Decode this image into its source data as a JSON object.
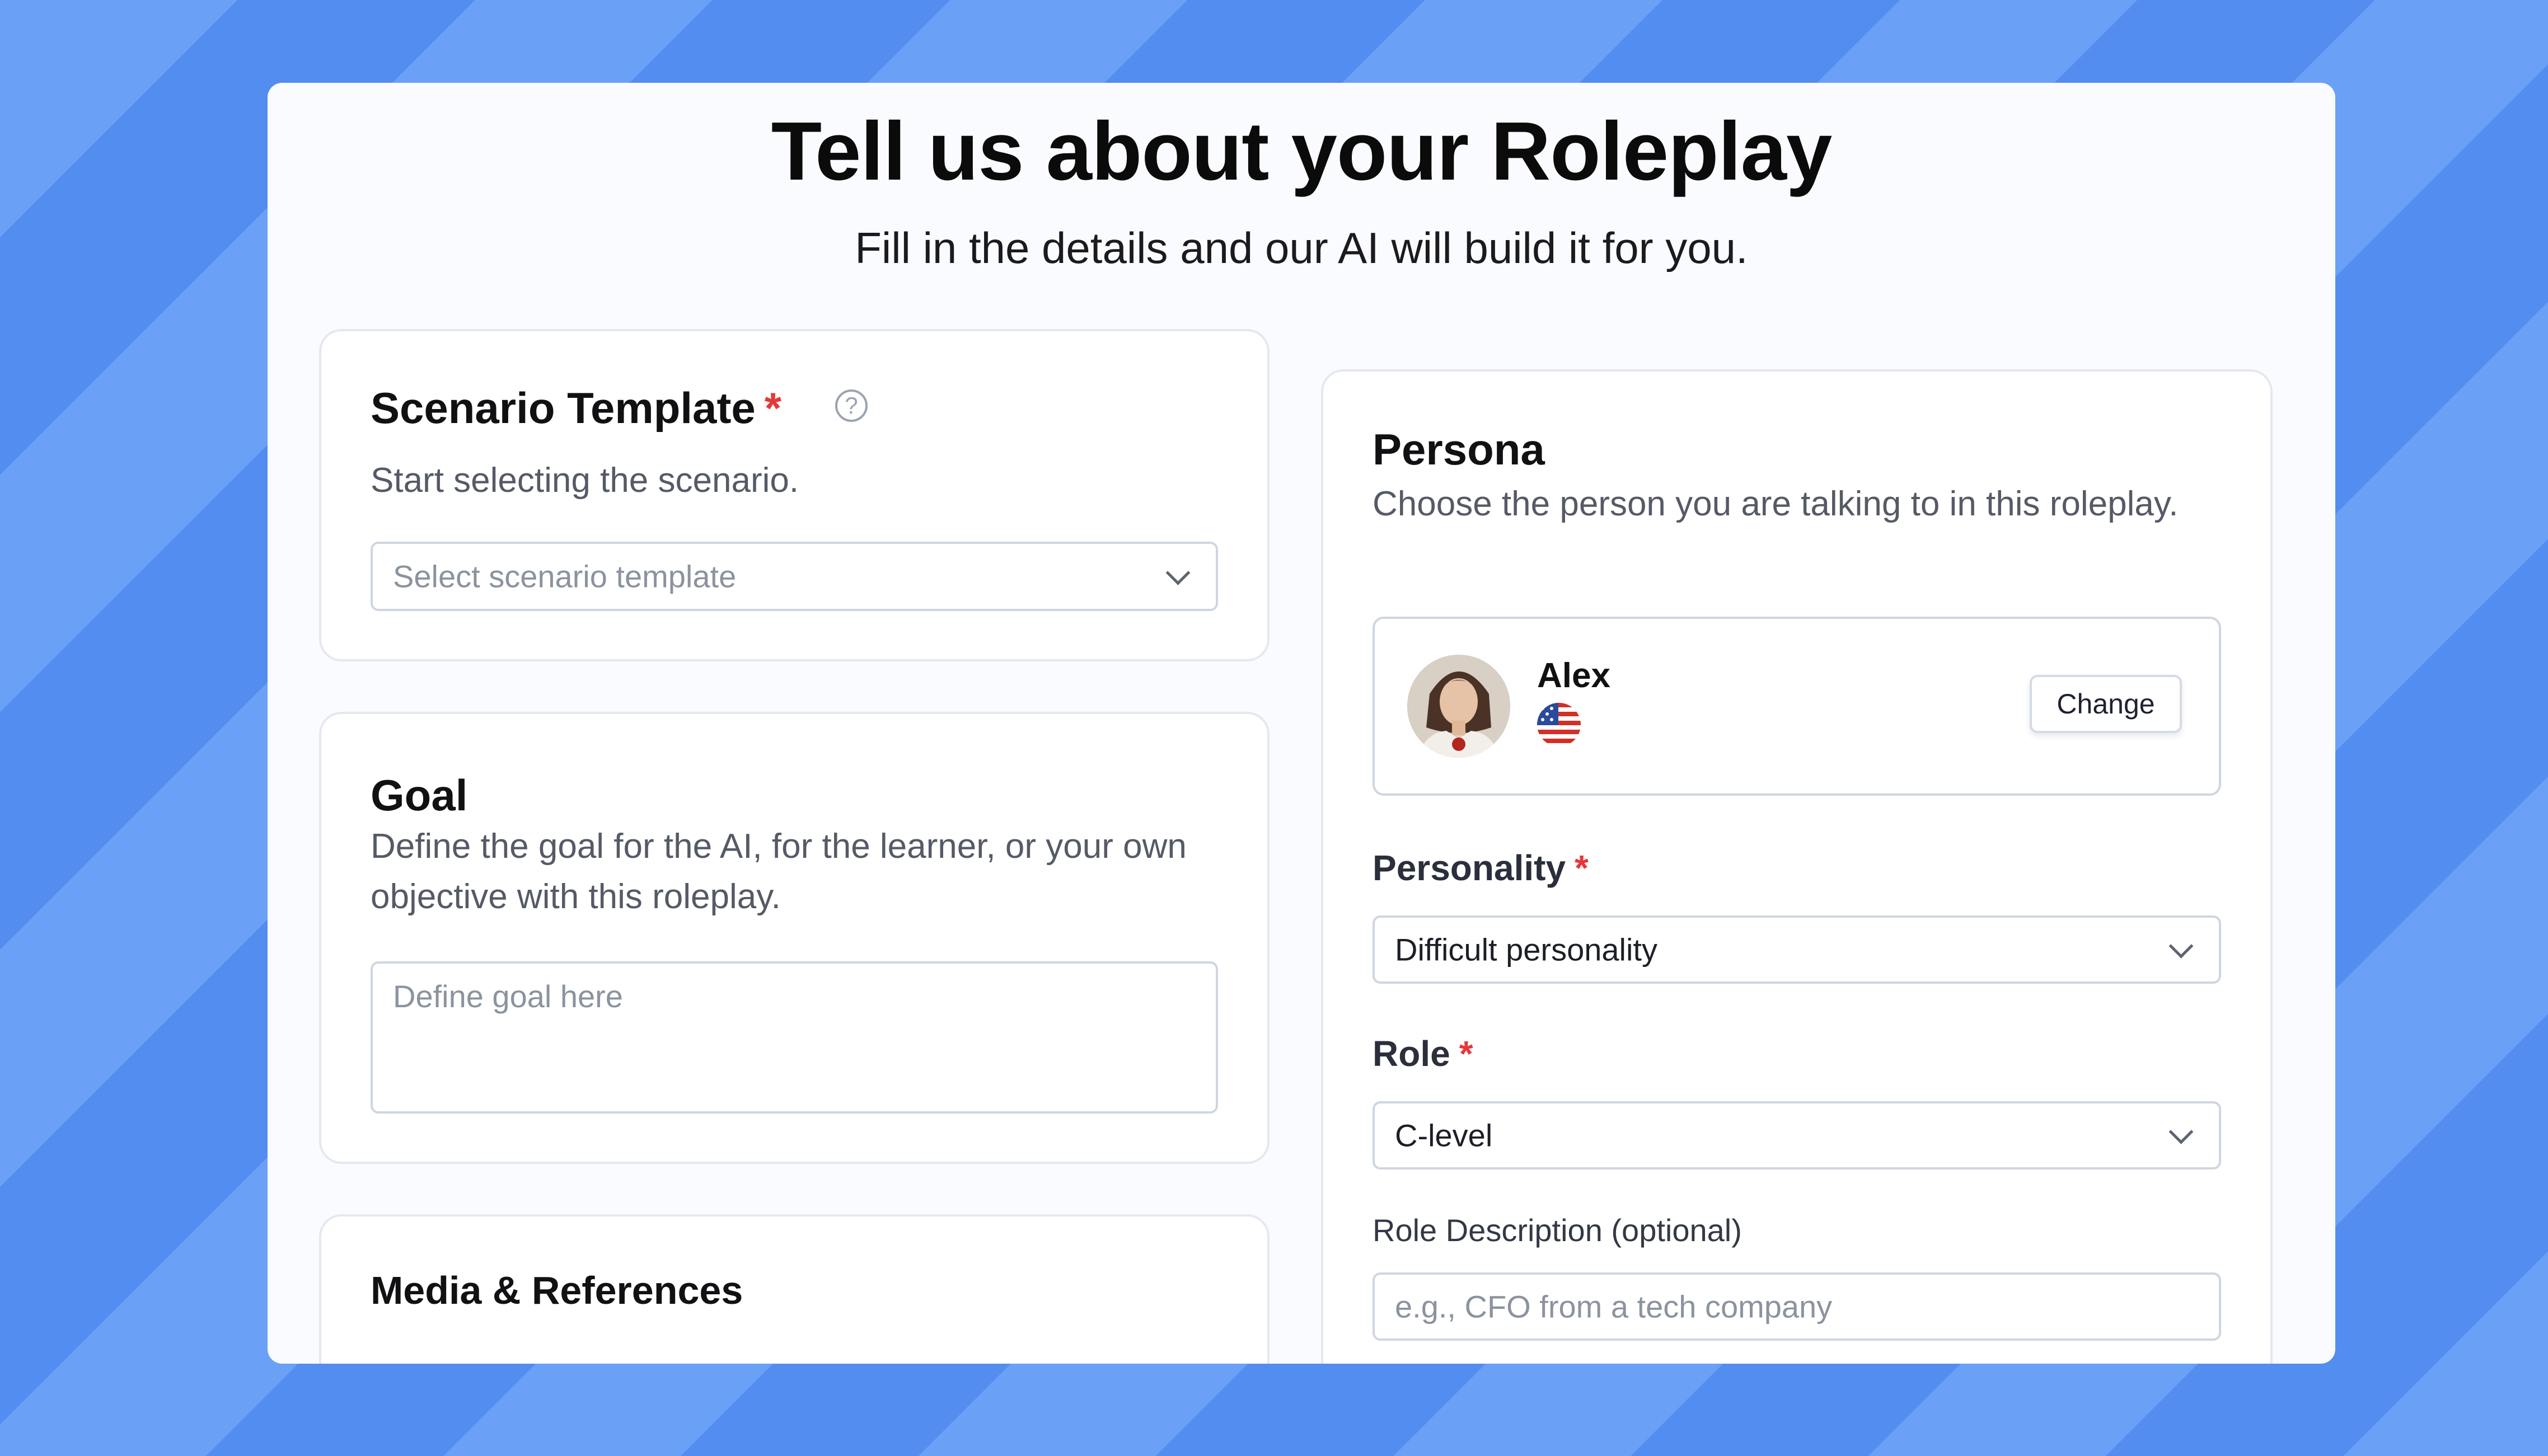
{
  "header": {
    "title": "Tell us about your Roleplay",
    "subtitle": "Fill in the details and our AI will build it for you."
  },
  "scenario": {
    "title": "Scenario Template",
    "required_mark": "*",
    "help_icon": "question-circle-icon",
    "help_glyph": "?",
    "description": "Start selecting the scenario.",
    "select_placeholder": "Select scenario template"
  },
  "goal": {
    "title": "Goal",
    "description": "Define the goal for the AI, for the learner, or your own objective with this roleplay.",
    "placeholder": "Define goal here"
  },
  "media": {
    "title": "Media & References"
  },
  "persona": {
    "title": "Persona",
    "description": "Choose the person you are talking to in this roleplay.",
    "selected": {
      "name": "Alex",
      "flag_icon": "us-flag-icon",
      "avatar_icon": "persona-avatar"
    },
    "change_label": "Change",
    "personality": {
      "label": "Personality",
      "required_mark": "*",
      "value": "Difficult personality"
    },
    "role": {
      "label": "Role",
      "required_mark": "*",
      "value": "C-level"
    },
    "role_description": {
      "label": "Role Description (optional)",
      "placeholder": "e.g., CFO from a tech company"
    }
  },
  "colors": {
    "background": "#5b93f2",
    "required": "#e5383b",
    "card_border": "#e4e8ef"
  }
}
